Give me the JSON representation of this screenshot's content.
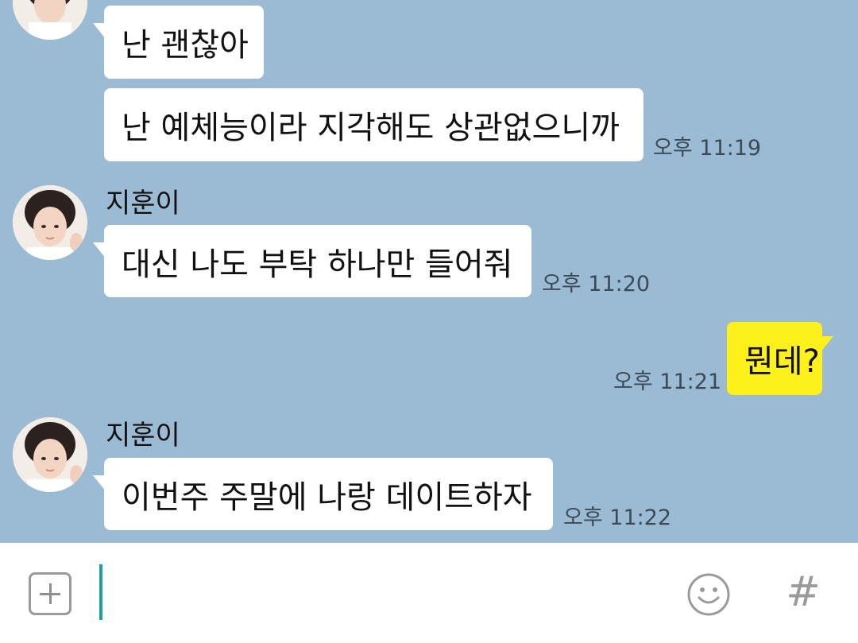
{
  "messages": [
    {
      "text": "난 괜찮아"
    },
    {
      "text": "난 예체능이라 지각해도 상관없으니까",
      "time": "오후 11:19"
    },
    {
      "sender": "지훈이",
      "text": "대신 나도 부탁 하나만 들어줘",
      "time": "오후 11:20"
    },
    {
      "text": "뭔데?",
      "time": "오후 11:21"
    },
    {
      "sender": "지훈이",
      "text": "이번주 주말에 나랑 데이트하자",
      "time": "오후 11:22"
    }
  ],
  "input": {
    "value": "",
    "placeholder": ""
  },
  "icons": {
    "attach": "plus-square-icon",
    "emoji": "smiley-icon",
    "hashtag": "hashtag-icon"
  },
  "colors": {
    "chat_background": "#9bbbd4",
    "my_bubble": "#fef01b",
    "other_bubble": "#ffffff",
    "cursor": "#1aa597"
  },
  "hash_glyph": "#"
}
